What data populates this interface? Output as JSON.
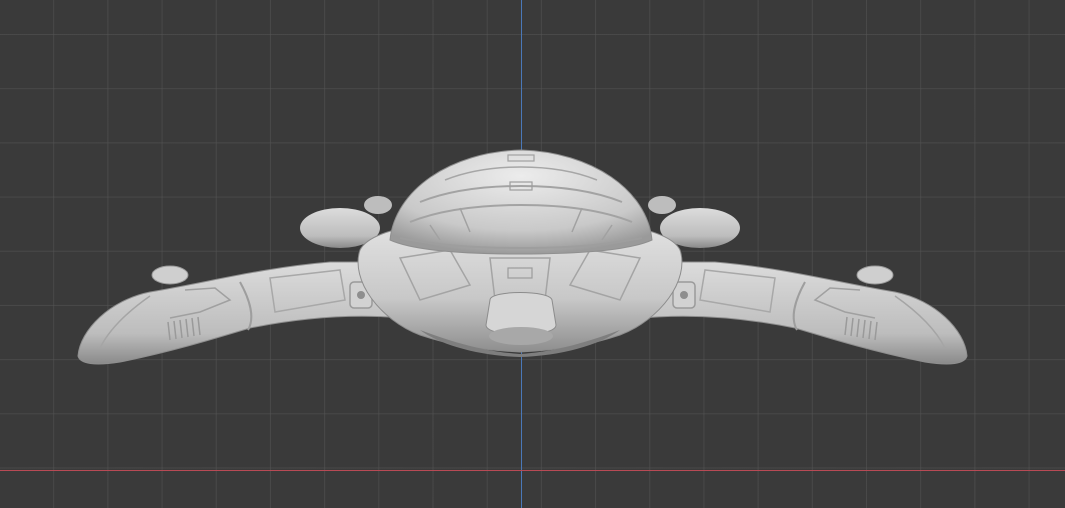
{
  "viewport": {
    "view": "3d-viewport",
    "background_color": "#3a3a3a",
    "grid_color": "#555555",
    "x_axis_color": "#b84a55",
    "y_axis_color": "#4a78b8",
    "model_color": "#cfcfcf"
  }
}
